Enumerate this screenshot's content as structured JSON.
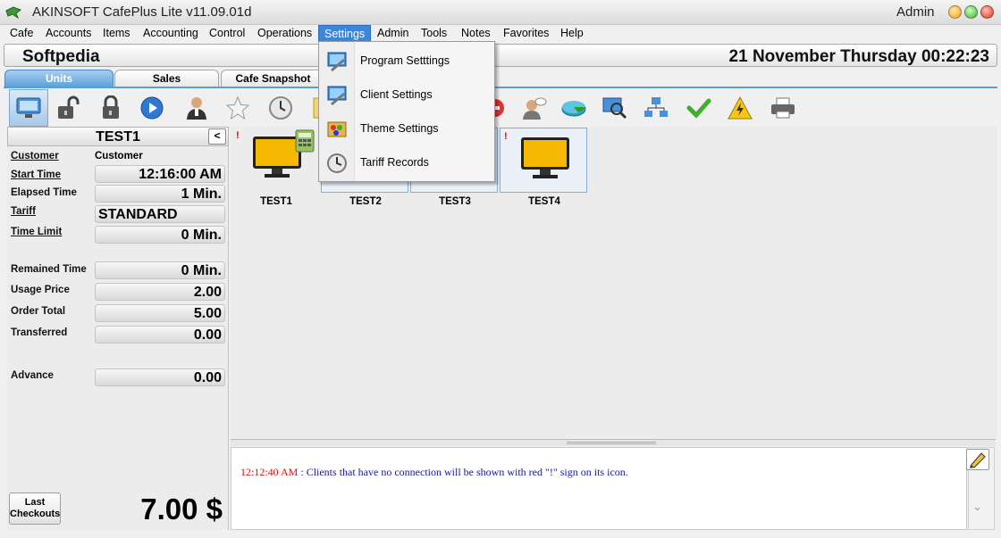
{
  "window": {
    "title": "AKINSOFT CafePlus Lite v11.09.01d",
    "user": "Admin",
    "controls": [
      "minimize-button",
      "maximize-button",
      "close-button"
    ]
  },
  "menu": {
    "items": [
      "Cafe",
      "Accounts",
      "Items",
      "Accounting",
      "Control",
      "Operations",
      "Settings",
      "Admin",
      "Tools",
      "Notes",
      "Favorites",
      "Help"
    ],
    "active": "Settings"
  },
  "settings_menu": {
    "items": [
      {
        "label": "Program Setttings",
        "icon": "monitor-tools-icon"
      },
      {
        "label": "Client Settings",
        "icon": "monitor-tools-icon"
      },
      {
        "label": "Theme Settings",
        "icon": "theme-palette-icon"
      },
      {
        "label": "Tariff Records",
        "icon": "clock-icon"
      }
    ]
  },
  "header": {
    "brand": "Softpedia",
    "datetime": "21 November Thursday  00:22:23"
  },
  "tabs": [
    {
      "label": "Units",
      "active": true
    },
    {
      "label": "Sales",
      "active": false
    },
    {
      "label": "Cafe Snapshot",
      "active": false
    }
  ],
  "toolbar": {
    "icons": [
      "computer-icon",
      "unlock-icon",
      "lock-icon",
      "play-icon",
      "user-icon",
      "star-icon",
      "clock-icon",
      "notes-icon",
      "stop-icon",
      "user-message-icon",
      "disk-icon",
      "search-monitor-icon",
      "network-icon",
      "checkmark-icon",
      "power-warning-icon",
      "printer-icon"
    ]
  },
  "selected_unit": {
    "name": "TEST1",
    "back_label": "<",
    "fields": {
      "customer_label": "Customer",
      "customer_value": "Customer",
      "start_time_label": "Start Time",
      "start_time_value": "12:16:00 AM",
      "elapsed_time_label": "Elapsed Time",
      "elapsed_time_value": "1 Min.",
      "tariff_label": "Tariff",
      "tariff_value": "STANDARD",
      "time_limit_label": "Time Limit",
      "time_limit_value": "0 Min.",
      "remained_time_label": "Remained Time",
      "remained_time_value": "0 Min.",
      "usage_price_label": "Usage Price",
      "usage_price_value": "2.00",
      "order_total_label": "Order Total",
      "order_total_value": "5.00",
      "transferred_label": "Transferred",
      "transferred_value": "0.00",
      "advance_label": "Advance",
      "advance_value": "0.00"
    },
    "last_checkouts_label": "Last Checkouts",
    "total": "7.00 $"
  },
  "units": [
    {
      "name": "TEST1",
      "warning": "!"
    },
    {
      "name": "TEST2",
      "warning": ""
    },
    {
      "name": "TEST3",
      "warning": ""
    },
    {
      "name": "TEST4",
      "warning": "!"
    }
  ],
  "log": {
    "time": "12:12:40 AM",
    "separator": " : ",
    "message": "Clients that have no connection will be shown with red \"!\" sign on its icon."
  },
  "colors": {
    "accent": "#5a9fd8",
    "menu_active": "#3d86d6",
    "log_time": "#e01010",
    "log_message": "#1616a8"
  }
}
